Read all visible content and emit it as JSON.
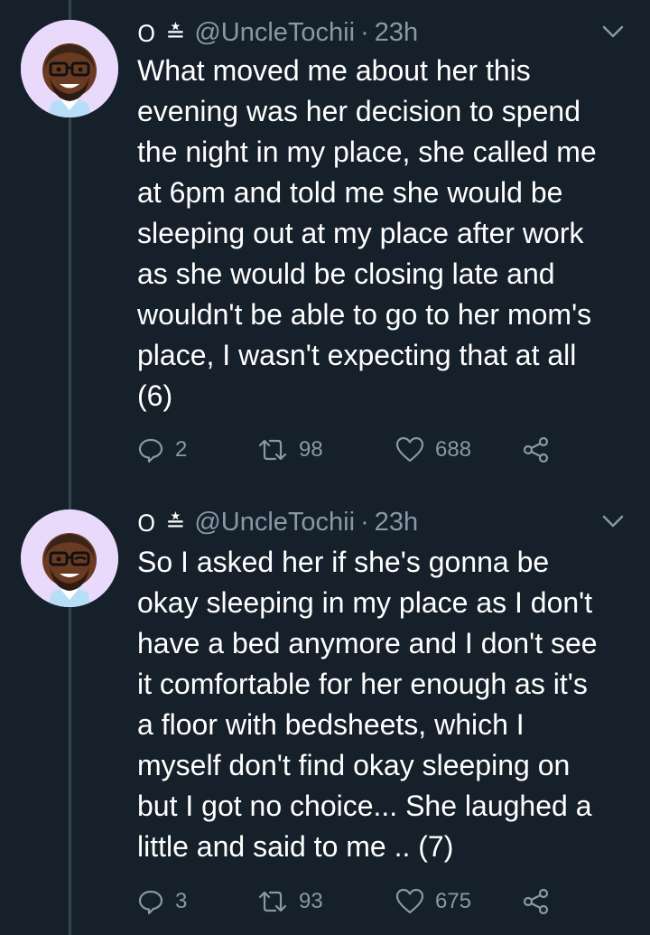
{
  "tweets": [
    {
      "badges": "ᱛ ≛",
      "handle": "@UncleTochii",
      "separator": "·",
      "time": "23h",
      "text": "What moved me about her this\nevening was her decision to spend\nthe night in my place,  she called me\nat 6pm and told me she would be\nsleeping out at my place after work\nas she would be closing late and\nwouldn't be able to go to her mom's\nplace, I wasn't expecting that at all\n(6)",
      "replies": "2",
      "retweets": "98",
      "likes": "688",
      "avatar_expression": "smile"
    },
    {
      "badges": "ᱛ ≛",
      "handle": "@UncleTochii",
      "separator": "·",
      "time": "23h",
      "text": "So I asked her if she's gonna be\nokay sleeping in my place as I don't\nhave a bed anymore and I don't see\nit comfortable for her enough as it's\na floor with bedsheets, which I\nmyself don't find okay sleeping on\nbut I got no choice... She laughed a\nlittle and said to me .. (7)",
      "replies": "3",
      "retweets": "93",
      "likes": "675",
      "avatar_expression": "wink"
    }
  ],
  "icons": {
    "reply": "reply-icon",
    "retweet": "retweet-icon",
    "like": "heart-icon",
    "share": "share-icon",
    "more": "chevron-down-icon"
  },
  "colors": {
    "background": "#15202b",
    "muted": "#8899a6",
    "thread_line": "#38444d",
    "avatar_bg": "#e9d9fb"
  }
}
